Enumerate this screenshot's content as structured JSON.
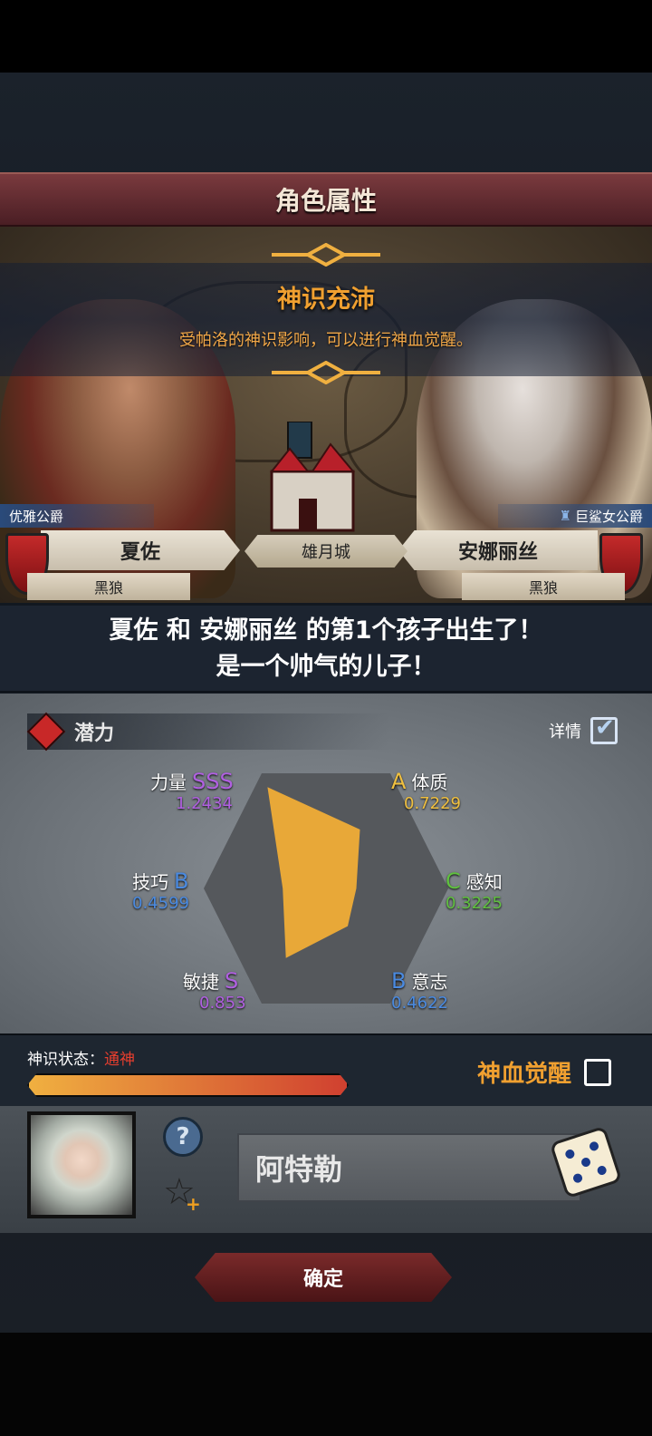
{
  "header": {
    "title": "角色属性"
  },
  "notification": {
    "title": "神识充沛",
    "description": "受帕洛的神识影响，可以进行神血觉醒。"
  },
  "father": {
    "title": "优雅公爵",
    "name": "夏佐",
    "house": "黑狼"
  },
  "mother": {
    "title": "巨鲨女公爵",
    "name": "安娜丽丝",
    "house": "黑狼"
  },
  "city": {
    "name": "雄月城"
  },
  "message": {
    "line1": "夏佐 和 安娜丽丝 的第1个孩子出生了！",
    "line2": "是一个帅气的儿子！"
  },
  "potential": {
    "label": "潜力",
    "detail_label": "详情",
    "attributes": [
      {
        "name": "力量",
        "grade": "SSS",
        "value": "1.2434",
        "color": "#b060e0"
      },
      {
        "name": "体质",
        "grade": "A",
        "value": "0.7229",
        "color": "#f0c040"
      },
      {
        "name": "感知",
        "grade": "C",
        "value": "0.3225",
        "color": "#60c040"
      },
      {
        "name": "意志",
        "grade": "B",
        "value": "0.4622",
        "color": "#4a8ae0"
      },
      {
        "name": "敏捷",
        "grade": "S",
        "value": "0.853",
        "color": "#b060e0"
      },
      {
        "name": "技巧",
        "grade": "B",
        "value": "0.4599",
        "color": "#4a8ae0"
      }
    ]
  },
  "divine": {
    "label": "神识状态：",
    "state": "通神",
    "progress": 1.0,
    "awaken_label": "神血觉醒"
  },
  "child": {
    "name": "阿特勒"
  },
  "confirm_label": "确定",
  "colors": {
    "accent": "#f0a030",
    "title_bar": "#6a2a30"
  }
}
